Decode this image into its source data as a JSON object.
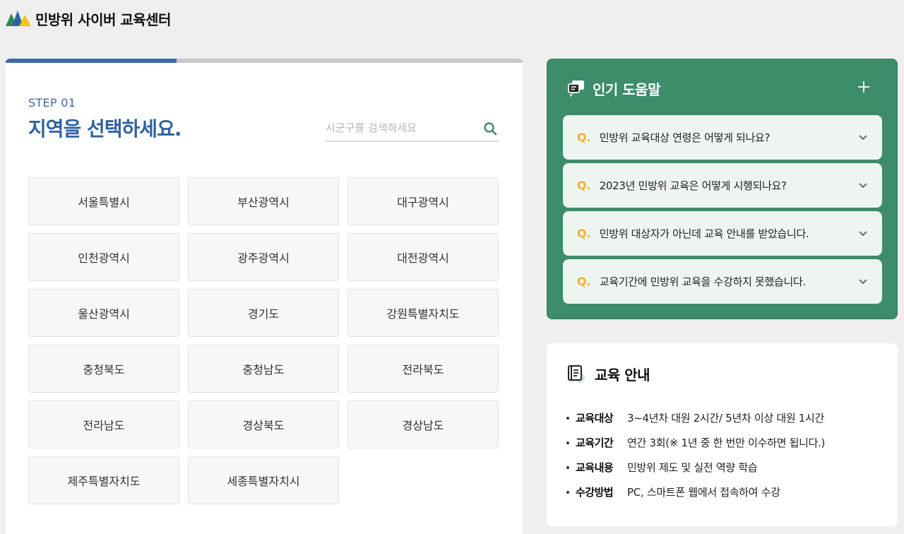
{
  "header": {
    "title": "민방위 사이버 교육센터"
  },
  "progress": {
    "fraction": 0.33
  },
  "step": {
    "label": "STEP 01",
    "title": "지역을 선택하세요.",
    "search_placeholder": "시군구를 검색하세요"
  },
  "regions": [
    "서울특별시",
    "부산광역시",
    "대구광역시",
    "인천광역시",
    "광주광역시",
    "대전광역시",
    "울산광역시",
    "경기도",
    "강원특별자치도",
    "충청북도",
    "충청남도",
    "전라북도",
    "전라남도",
    "경상북도",
    "경상남도",
    "제주특별자치도",
    "세종특별자치시"
  ],
  "help": {
    "title": "인기 도움말",
    "q_marker": "Q.",
    "items": [
      "민방위 교육대상 연령은 어떻게 되나요?",
      "2023년 민방위 교육은 어떻게 시행되나요?",
      "민방위 대상자가 아닌데 교육 안내를 받았습니다.",
      "교육기간에 민방위 교육을 수강하지 못했습니다."
    ]
  },
  "info": {
    "title": "교육 안내",
    "rows": [
      {
        "key": "교육대상",
        "value": "3~4년차 대원 2시간/ 5년차 이상 대원 1시간"
      },
      {
        "key": "교육기간",
        "value": "연간 3회(※ 1년 중 한 번만 이수하면 됩니다.)"
      },
      {
        "key": "교육내용",
        "value": "민방위 제도 및 실전 역량 학습"
      },
      {
        "key": "수강방법",
        "value": "PC, 스마트폰 웹에서 접속하여 수강"
      }
    ]
  },
  "colors": {
    "accent_blue": "#3a6aa8",
    "help_green": "#3d8c6a",
    "q_yellow": "#f2b233"
  },
  "icons": {
    "logo": "mountain-logo-icon",
    "search": "search-icon",
    "help": "chat-bubbles-icon",
    "plus": "plus-icon",
    "chevron": "chevron-down-icon",
    "info": "notebook-icon"
  }
}
